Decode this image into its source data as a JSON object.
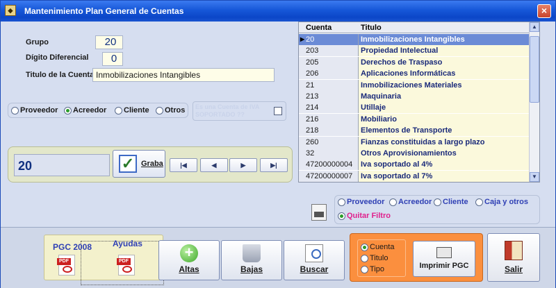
{
  "window": {
    "title": "Mantenimiento Plan General de Cuentas",
    "close_glyph": "×"
  },
  "form": {
    "grupo_label": "Grupo",
    "grupo_value": "20",
    "digito_label": "Dígito Diferencial",
    "digito_value": "0",
    "titulo_label": "Titulo de la Cuenta",
    "titulo_value": "Inmobilizaciones Intangibles"
  },
  "tipo_radio": {
    "options": [
      "Proveedor",
      "Acreedor",
      "Cliente",
      "Otros"
    ],
    "selected": "Acreedor"
  },
  "iva": {
    "label": "Es una Cuenta de IVA SOPORTADO ??",
    "checked": false
  },
  "navigator": {
    "current_value": "20",
    "save_label": "Graba",
    "buttons": [
      "|◀",
      "◀",
      "▶",
      "▶|"
    ]
  },
  "grid": {
    "columns": [
      "Cuenta",
      "Titulo"
    ],
    "rows": [
      {
        "cuenta": "20",
        "titulo": "Inmobilizaciones Intangibles",
        "selected": true
      },
      {
        "cuenta": "203",
        "titulo": "Propiedad Intelectual"
      },
      {
        "cuenta": "205",
        "titulo": "Derechos de Traspaso"
      },
      {
        "cuenta": "206",
        "titulo": "Aplicaciones Informáticas"
      },
      {
        "cuenta": "21",
        "titulo": "Inmobilizaciones Materiales"
      },
      {
        "cuenta": "213",
        "titulo": "Maquinaria"
      },
      {
        "cuenta": "214",
        "titulo": "Utillaje"
      },
      {
        "cuenta": "216",
        "titulo": "Mobiliario"
      },
      {
        "cuenta": "218",
        "titulo": "Elementos de Transporte"
      },
      {
        "cuenta": "260",
        "titulo": "Fianzas constituidas a largo plazo"
      },
      {
        "cuenta": "32",
        "titulo": "Otros Aprovisionamientos"
      },
      {
        "cuenta": "47200000004",
        "titulo": "Iva soportado al 4%"
      },
      {
        "cuenta": "47200000007",
        "titulo": "Iva soportado al 7%"
      }
    ]
  },
  "filter": {
    "options": [
      "Proveedor",
      "Acreedor",
      "Cliente",
      "Caja y otros"
    ],
    "quitar_label": "Quitar Filtro",
    "selected": "Quitar Filtro"
  },
  "bottom": {
    "pgc_label": "PGC 2008",
    "ayudas_label": "Ayudas",
    "pdf_tag": "PDF",
    "altas_label": "Altas",
    "bajas_label": "Bajas",
    "buscar_label": "Buscar",
    "order_options": [
      "Cuenta",
      "Titulo",
      "Tipo"
    ],
    "order_selected": "Cuenta",
    "imprimir_label": "Imprimir PGC",
    "salir_label": "Salir"
  },
  "colors": {
    "title_bar": "#1657d8",
    "selected_row": "#6b8bd6",
    "orange_panel": "#fb8f3e",
    "filter_text": "#2e3fb4",
    "quitar_filtro": "#e0208c"
  }
}
